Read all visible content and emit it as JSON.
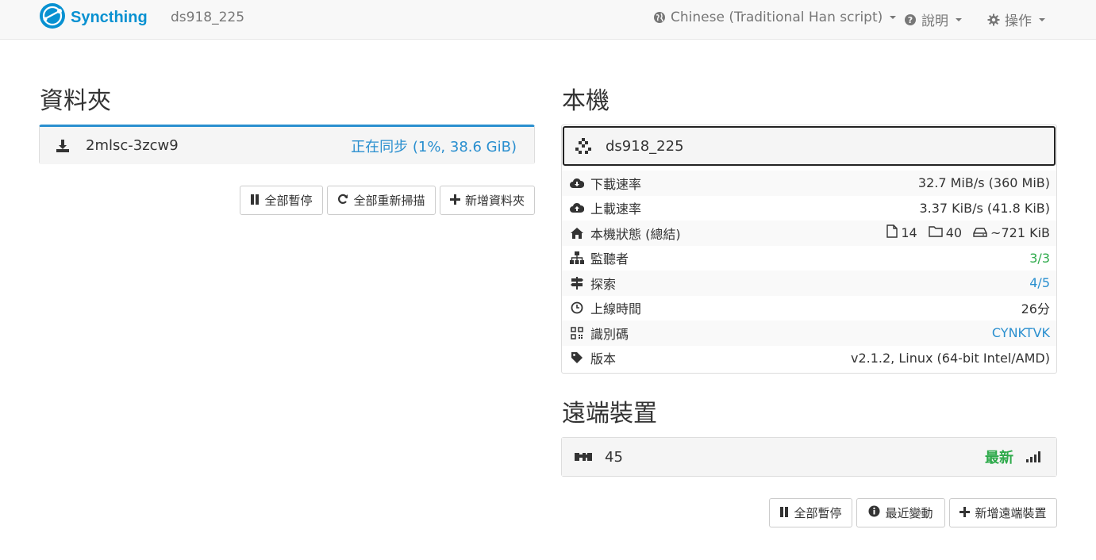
{
  "navbar": {
    "brand": "Syncthing",
    "device_name": "ds918_225",
    "language": "Chinese (Traditional Han script)",
    "help": "說明",
    "actions": "操作"
  },
  "folders": {
    "title": "資料夾",
    "items": [
      {
        "name": "2mlsc-3zcw9",
        "status": "正在同步 (1%, 38.6 GiB)"
      }
    ],
    "buttons": {
      "pause_all": "全部暫停",
      "rescan_all": "全部重新掃描",
      "add_folder": "新增資料夾"
    }
  },
  "this_device": {
    "title": "本機",
    "name": "ds918_225",
    "rows": [
      {
        "label": "下載速率",
        "value": "32.7 MiB/s (360 MiB)"
      },
      {
        "label": "上載速率",
        "value": "3.37 KiB/s (41.8 KiB)"
      },
      {
        "label": "本機狀態 (總結)",
        "files": "14",
        "dirs": "40",
        "size": "~721 KiB"
      },
      {
        "label": "監聽者",
        "value": "3/3"
      },
      {
        "label": "探索",
        "value": "4/5"
      },
      {
        "label": "上線時間",
        "value": "26分"
      },
      {
        "label": "識別碼",
        "value": "CYNKTVK"
      },
      {
        "label": "版本",
        "value": "v2.1.2, Linux (64-bit Intel/AMD)"
      }
    ]
  },
  "remote_devices": {
    "title": "遠端裝置",
    "items": [
      {
        "name": "45",
        "status": "最新"
      }
    ],
    "buttons": {
      "pause_all": "全部暫停",
      "recent_changes": "最近變動",
      "add_device": "新增遠端裝置"
    }
  },
  "colors": {
    "brand": "#0891d1",
    "syncing": "#2a8fcf",
    "success": "#2eaa4b",
    "link": "#2a8fcf"
  },
  "icons": [
    "syncthing-logo",
    "globe-icon",
    "question-icon",
    "gear-icon",
    "download-icon",
    "pause-icon",
    "refresh-icon",
    "plus-icon",
    "identicon",
    "cloud-download-icon",
    "cloud-upload-icon",
    "home-icon",
    "file-icon",
    "folder-icon",
    "hdd-icon",
    "sitemap-icon",
    "signpost-icon",
    "clock-icon",
    "qrcode-icon",
    "tag-icon",
    "signal-icon",
    "info-icon"
  ]
}
